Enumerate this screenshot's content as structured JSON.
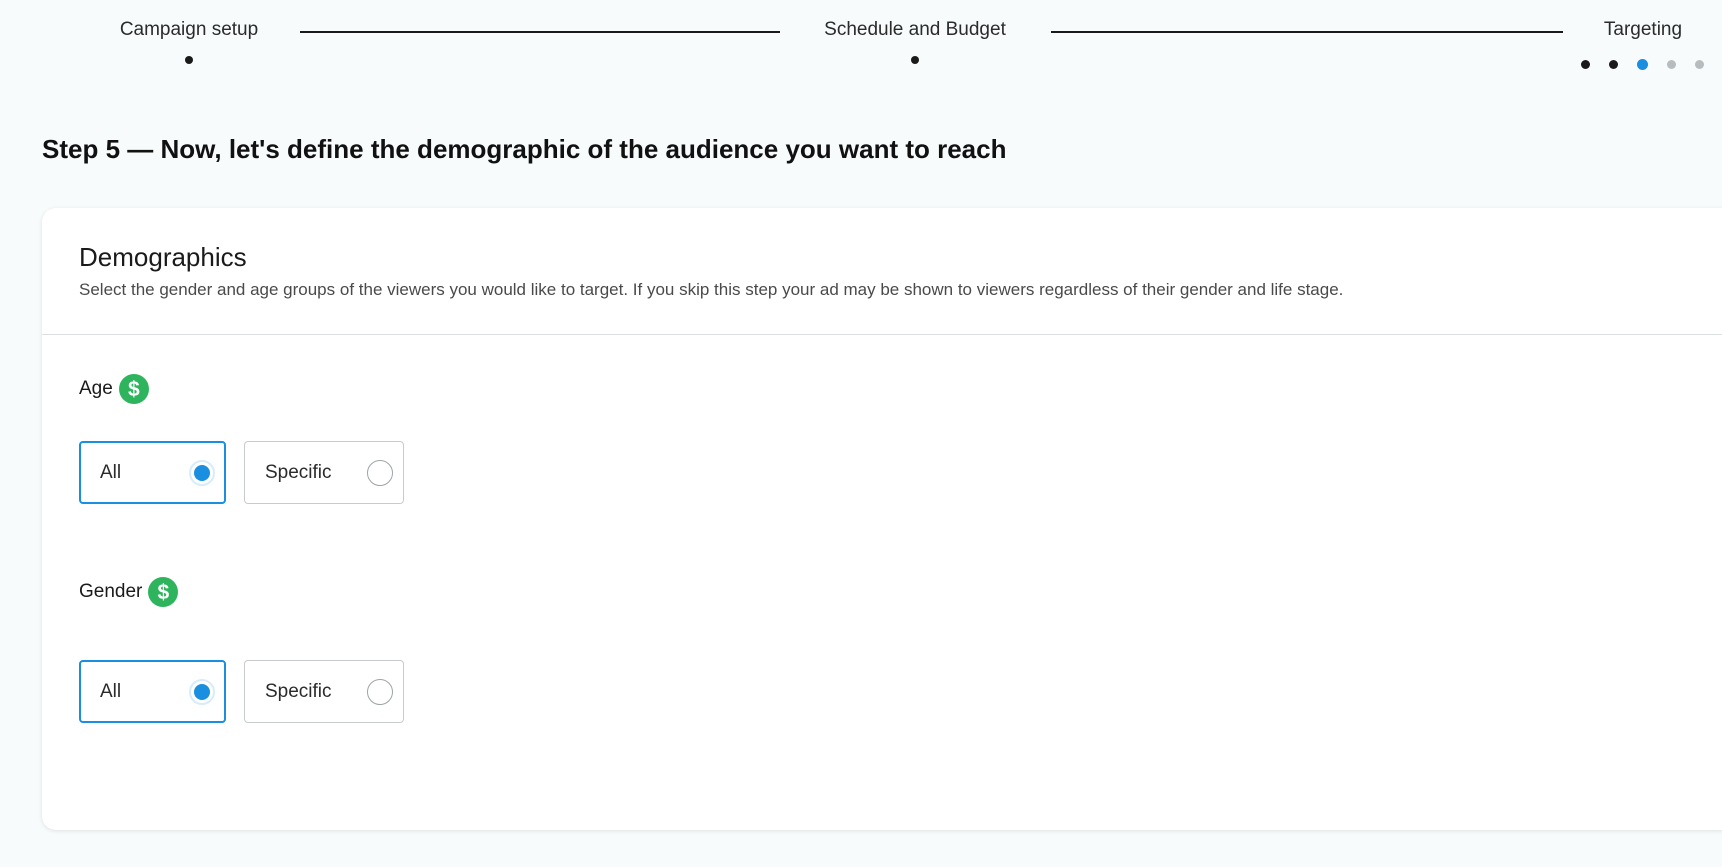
{
  "stepper": {
    "steps": [
      {
        "label": "Campaign setup",
        "state": "done"
      },
      {
        "label": "Schedule and Budget",
        "state": "done"
      },
      {
        "label": "Targeting",
        "state": "active"
      }
    ],
    "substeps": [
      "done",
      "done",
      "current",
      "upcoming",
      "upcoming"
    ]
  },
  "heading": "Step 5 — Now, let's define the demographic of the audience you want to reach",
  "card": {
    "title": "Demographics",
    "description": "Select the gender and age groups of the viewers you would like to target. If you skip this step your ad may be shown to viewers regardless of their gender and life stage.",
    "age": {
      "label": "Age",
      "icon": "dollar-icon",
      "options": [
        {
          "label": "All",
          "selected": true
        },
        {
          "label": "Specific",
          "selected": false
        }
      ]
    },
    "gender": {
      "label": "Gender",
      "icon": "dollar-icon",
      "options": [
        {
          "label": "All",
          "selected": true
        },
        {
          "label": "Specific",
          "selected": false
        }
      ]
    }
  },
  "colors": {
    "accent": "#1a8fe0",
    "dollar_badge": "#2fb45e",
    "background": "#f7fbfc"
  },
  "icons": {
    "dollar": "$"
  }
}
